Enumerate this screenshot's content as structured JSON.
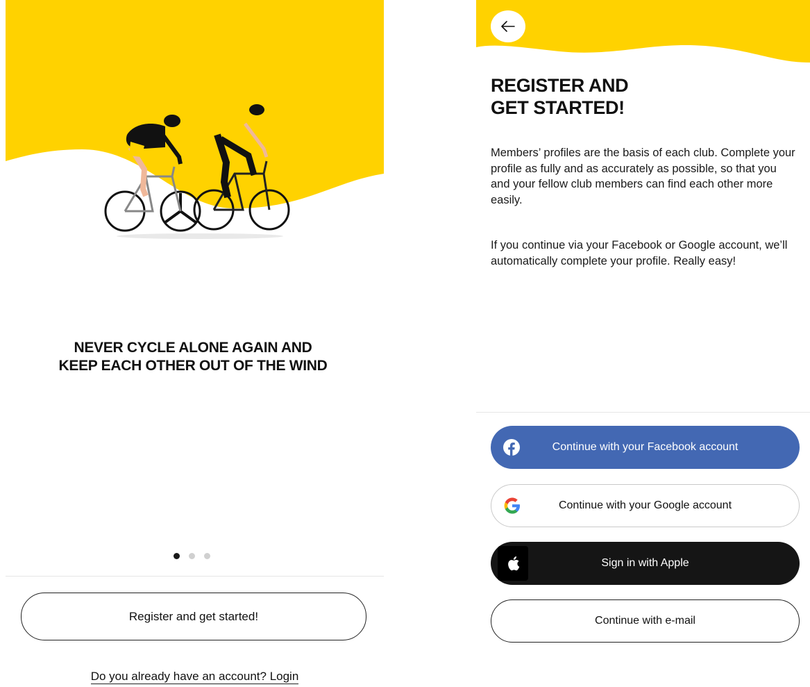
{
  "colors": {
    "brand_yellow": "#ffd200",
    "facebook_blue": "#4368b3",
    "apple_black": "#151515",
    "text_dark": "#111111",
    "divider": "#e6e6e6"
  },
  "onboarding": {
    "tagline": "NEVER CYCLE ALONE AGAIN AND KEEP EACH OTHER OUT OF THE WIND",
    "carousel": {
      "total": 3,
      "active_index": 0
    },
    "register_button": "Register and get started!",
    "login_prompt": "Do you already have an account? Login",
    "illustration_icon": "two-cyclists-illustration"
  },
  "register": {
    "back_icon": "arrow-left-icon",
    "heading_line1": "REGISTER AND",
    "heading_line2": "GET STARTED!",
    "paragraph1": "Members’ profiles are the basis of each club. Complete your profile as fully and as accurately as possible, so that you and your fellow club members can find each other more easily.",
    "paragraph2": "If you continue via your Facebook or Google account, we’ll automatically complete your profile. Really easy!",
    "buttons": {
      "facebook": "Continue with your Facebook account",
      "google": "Continue with your Google account",
      "apple": "Sign in with Apple",
      "email": "Continue with e-mail"
    }
  }
}
